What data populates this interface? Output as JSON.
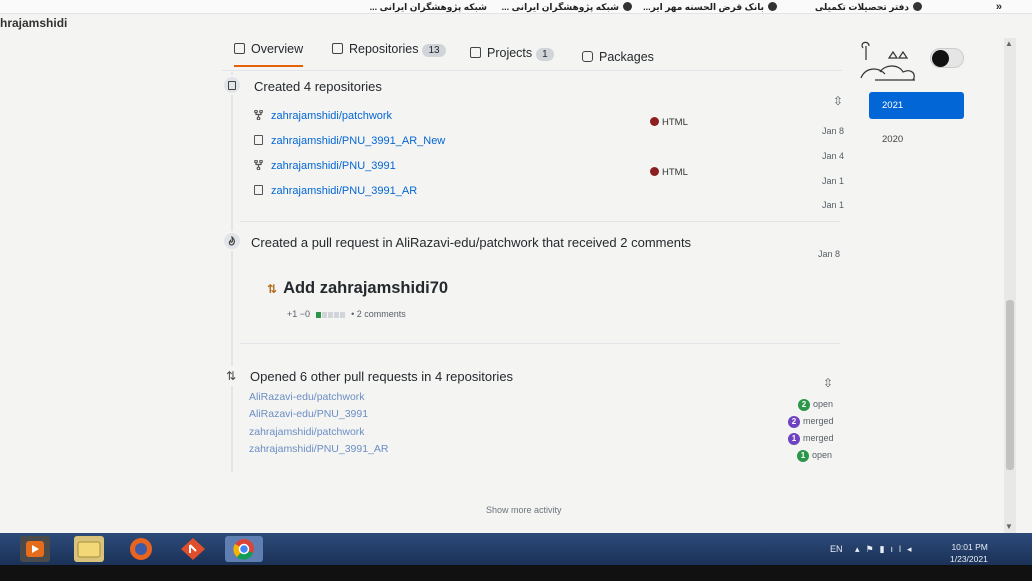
{
  "bookmarks": [
    "دفتر تحصیلات تکمیلی",
    "بانک قرض الحسنه مهر ایر...",
    "شبکه پژوهشگران ایرانی ...",
    "شبکه پژوهشگران ایرانی ..."
  ],
  "bookmarks_more": "»",
  "profile": {
    "username": "hrajamshidi"
  },
  "tabs": [
    {
      "label": "Overview",
      "count": null,
      "active": true
    },
    {
      "label": "Repositories",
      "count": "13",
      "active": false
    },
    {
      "label": "Projects",
      "count": "1",
      "active": false
    },
    {
      "label": "Packages",
      "count": null,
      "active": false
    }
  ],
  "created_repos": {
    "title": "Created 4 repositories",
    "items": [
      {
        "name": "zahrajamshidi/patchwork",
        "icon": "fork-icon",
        "language": "HTML",
        "date": "Jan 8"
      },
      {
        "name": "zahrajamshidi/PNU_3991_AR_New",
        "icon": "repo-icon",
        "language": "",
        "date": "Jan 4"
      },
      {
        "name": "zahrajamshidi/PNU_3991",
        "icon": "fork-icon",
        "language": "HTML",
        "date": "Jan 1"
      },
      {
        "name": "zahrajamshidi/PNU_3991_AR",
        "icon": "repo-icon",
        "language": "",
        "date": "Jan 1"
      }
    ]
  },
  "pull_request": {
    "title": "Created a pull request in AliRazavi-edu/patchwork that received 2 comments",
    "date": "Jan 8",
    "pr_title": "Add zahrajamshidi70",
    "additions": "+1",
    "deletions": "−0",
    "comments": "• 2 comments"
  },
  "opened_prs": {
    "title": "Opened 6 other pull requests in 4 repositories",
    "items": [
      {
        "repo": "AliRazavi-edu/patchwork",
        "count": "2",
        "state": "open",
        "color": "#2c974b"
      },
      {
        "repo": "AliRazavi-edu/PNU_3991",
        "count": "2",
        "state": "merged",
        "color": "#6f42c1"
      },
      {
        "repo": "zahrajamshidi/patchwork",
        "count": "1",
        "state": "merged",
        "color": "#6f42c1"
      },
      {
        "repo": "zahrajamshidi/PNU_3991_AR",
        "count": "1",
        "state": "open",
        "color": "#2c974b"
      }
    ]
  },
  "show_more": "Show more activity",
  "years": [
    {
      "label": "2021",
      "active": true
    },
    {
      "label": "2020",
      "active": false
    }
  ],
  "taskbar": {
    "lang": "EN",
    "time": "10:01 PM",
    "date": "1/23/2021"
  },
  "colors": {
    "link": "#0366d6",
    "accent_tab": "#e36209",
    "html_lang": "#8b1e1e",
    "year_active": "#0366d6"
  }
}
